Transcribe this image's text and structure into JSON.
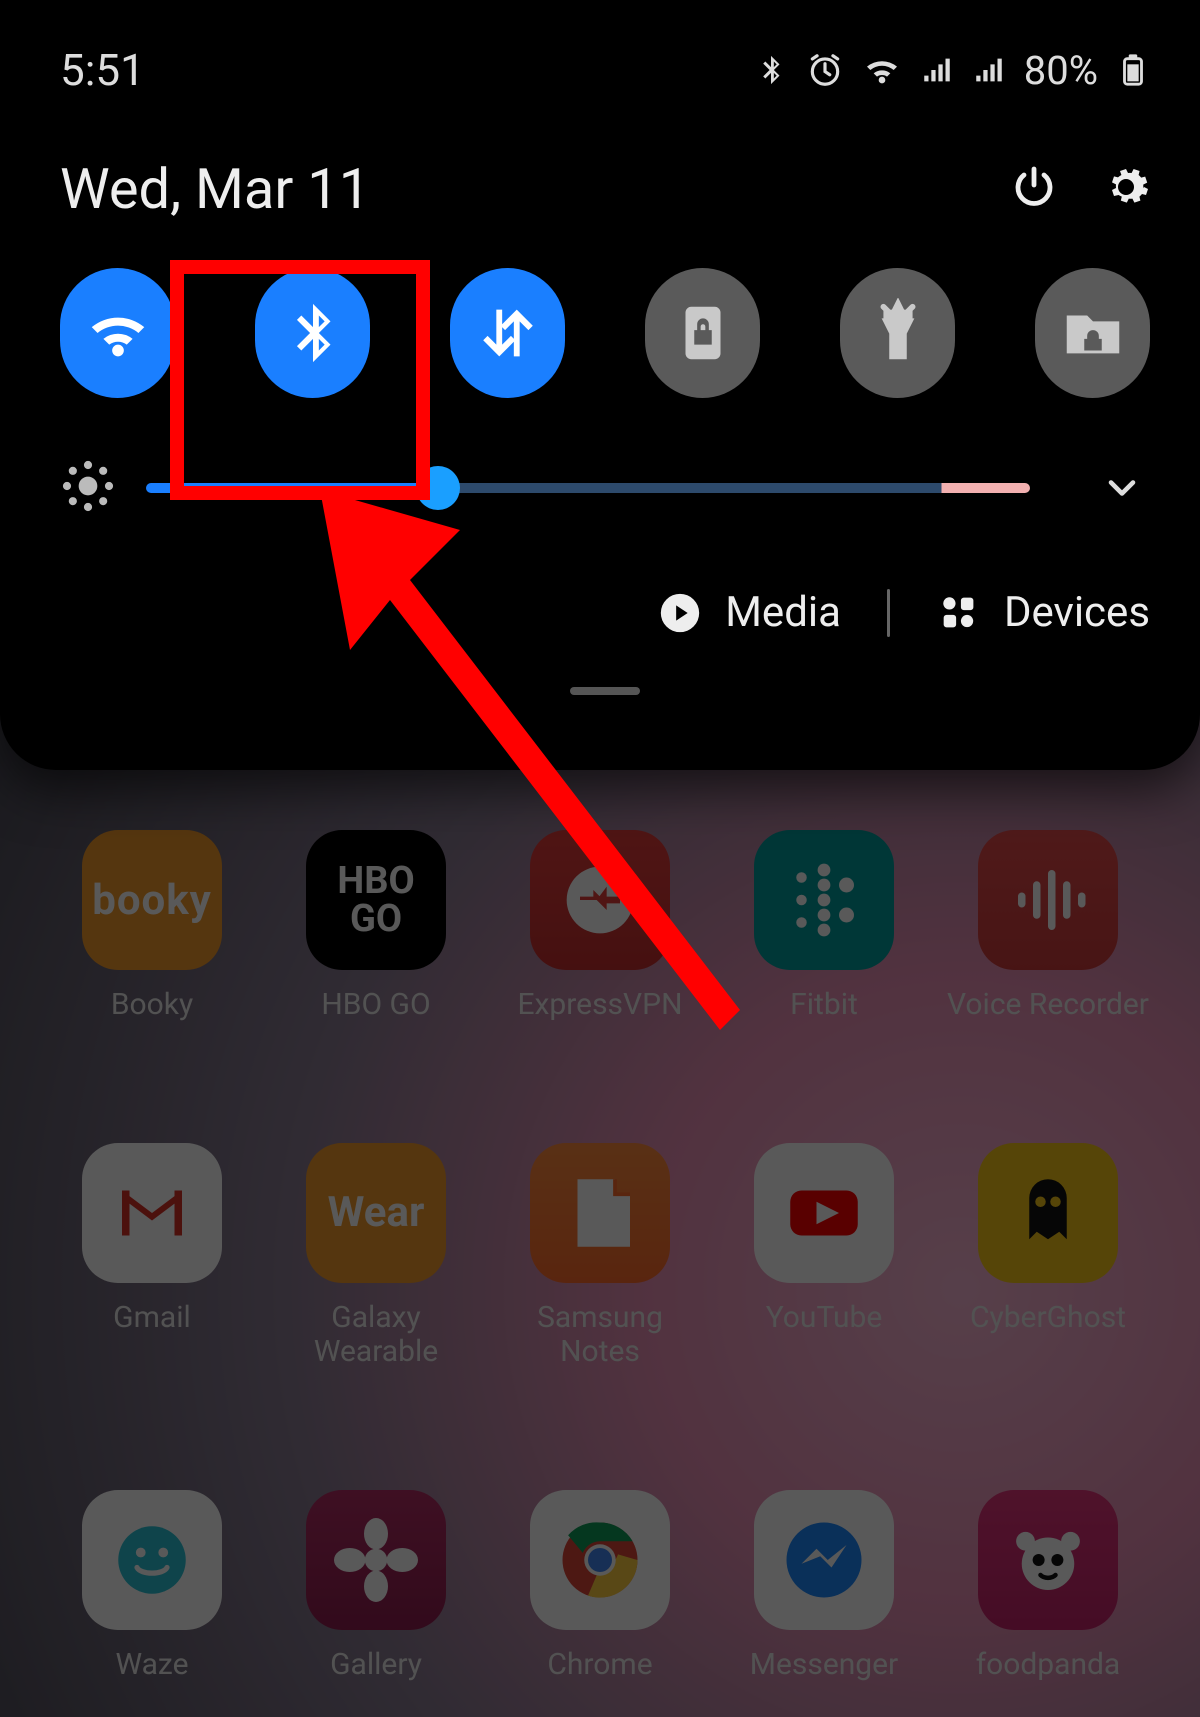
{
  "statusbar": {
    "time": "5:51",
    "battery_percent": "80%",
    "icons": [
      "bluetooth",
      "alarm",
      "wifi",
      "signal1",
      "signal2"
    ]
  },
  "date_row": {
    "date": "Wed, Mar 11"
  },
  "toggles": [
    {
      "name": "wifi",
      "state": "on"
    },
    {
      "name": "bluetooth",
      "state": "on"
    },
    {
      "name": "mobile-data",
      "state": "on"
    },
    {
      "name": "rotation-lock",
      "state": "off"
    },
    {
      "name": "flashlight",
      "state": "off"
    },
    {
      "name": "secure-folder",
      "state": "off"
    }
  ],
  "brightness": {
    "value_percent": 33
  },
  "controls": {
    "media_label": "Media",
    "devices_label": "Devices"
  },
  "apps": [
    {
      "label": "Booky",
      "icon": "booky"
    },
    {
      "label": "HBO GO",
      "icon": "hbogo"
    },
    {
      "label": "ExpressVPN",
      "icon": "expressvpn"
    },
    {
      "label": "Fitbit",
      "icon": "fitbit"
    },
    {
      "label": "Voice Recorder",
      "icon": "voicerec"
    },
    {
      "label": "Gmail",
      "icon": "gmail"
    },
    {
      "label": "Galaxy Wearable",
      "icon": "wear"
    },
    {
      "label": "Samsung Notes",
      "icon": "notes"
    },
    {
      "label": "YouTube",
      "icon": "youtube"
    },
    {
      "label": "CyberGhost",
      "icon": "cyberghost"
    },
    {
      "label": "Waze",
      "icon": "waze"
    },
    {
      "label": "Gallery",
      "icon": "gallery"
    },
    {
      "label": "Chrome",
      "icon": "chrome"
    },
    {
      "label": "Messenger",
      "icon": "messenger"
    },
    {
      "label": "foodpanda",
      "icon": "foodpanda"
    }
  ],
  "annotation": {
    "highlight_target": "bluetooth-toggle",
    "arrow_color": "#ff0000"
  }
}
